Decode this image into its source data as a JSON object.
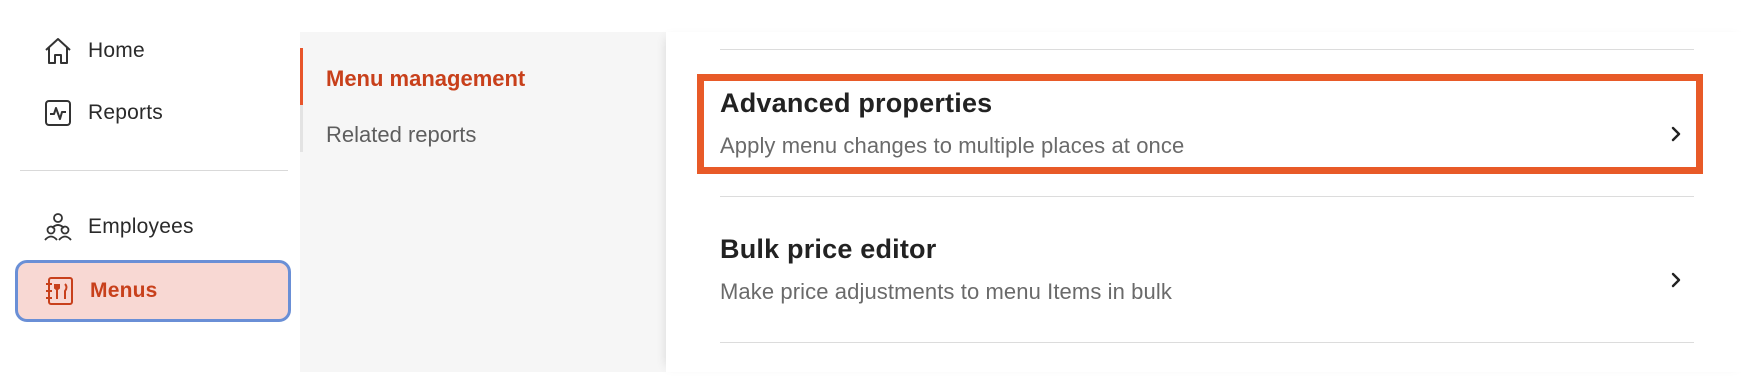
{
  "sidebar": {
    "items": [
      {
        "label": "Home",
        "icon": "home-icon"
      },
      {
        "label": "Reports",
        "icon": "reports-icon"
      },
      {
        "label": "Employees",
        "icon": "employees-icon"
      },
      {
        "label": "Menus",
        "icon": "menus-icon",
        "active": true
      }
    ]
  },
  "subnav": {
    "items": [
      {
        "label": "Menu management",
        "active": true
      },
      {
        "label": "Related reports",
        "active": false
      }
    ]
  },
  "main": {
    "rows": [
      {
        "title": "Advanced properties",
        "description": "Apply menu changes to multiple places at once",
        "highlighted": true
      },
      {
        "title": "Bulk price editor",
        "description": "Make price adjustments to menu Items in bulk",
        "highlighted": false
      }
    ]
  },
  "colors": {
    "accent": "#e8552b",
    "active_text": "#c8401b",
    "active_bg": "#f8d8d3",
    "focus_outline": "#6a8fd6",
    "highlight_box": "#e85a28"
  }
}
